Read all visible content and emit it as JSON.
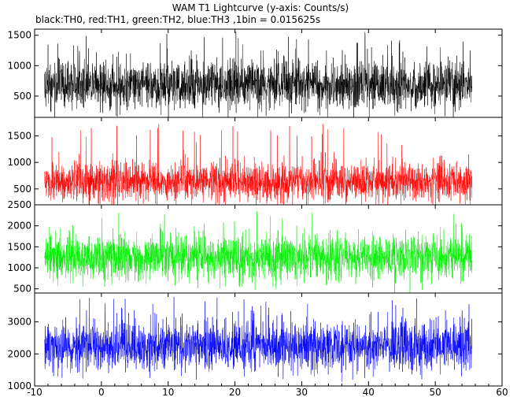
{
  "title": "WAM T1 Lightcurve (y-axis: Counts/s)",
  "subtitle": "black:TH0, red:TH1, green:TH2, blue:TH3 ,1bin = 0.015625s",
  "chart_data": {
    "type": "line",
    "grid": false,
    "x_range": [
      -10,
      60
    ],
    "x_ticks": [
      -10,
      0,
      10,
      20,
      30,
      40,
      50,
      60
    ],
    "x_data_range": [
      -8.5,
      55.5
    ],
    "bin_seconds": 0.015625,
    "panels": [
      {
        "name": "TH0",
        "color": "#000000",
        "ylim": [
          150,
          1600
        ],
        "y_ticks": [
          500,
          1000,
          1500
        ],
        "mean": 680,
        "spread": 200,
        "typical_range": [
          300,
          1300
        ],
        "peak": 1560
      },
      {
        "name": "TH1",
        "color": "#ff0000",
        "ylim": [
          200,
          1850
        ],
        "y_ticks": [
          500,
          1000,
          1500
        ],
        "mean": 640,
        "spread": 190,
        "typical_range": [
          300,
          1200
        ],
        "peak": 1750
      },
      {
        "name": "TH2",
        "color": "#00ee00",
        "ylim": [
          400,
          2500
        ],
        "y_ticks": [
          500,
          1000,
          1500,
          2000,
          2500
        ],
        "mean": 1250,
        "spread": 260,
        "typical_range": [
          700,
          2000
        ],
        "peak": 2350
      },
      {
        "name": "TH3",
        "color": "#0000ff",
        "ylim": [
          1000,
          3900
        ],
        "y_ticks": [
          1000,
          2000,
          3000
        ],
        "mean": 2250,
        "spread": 380,
        "typical_range": [
          1400,
          3300
        ],
        "peak": 3800
      }
    ]
  }
}
